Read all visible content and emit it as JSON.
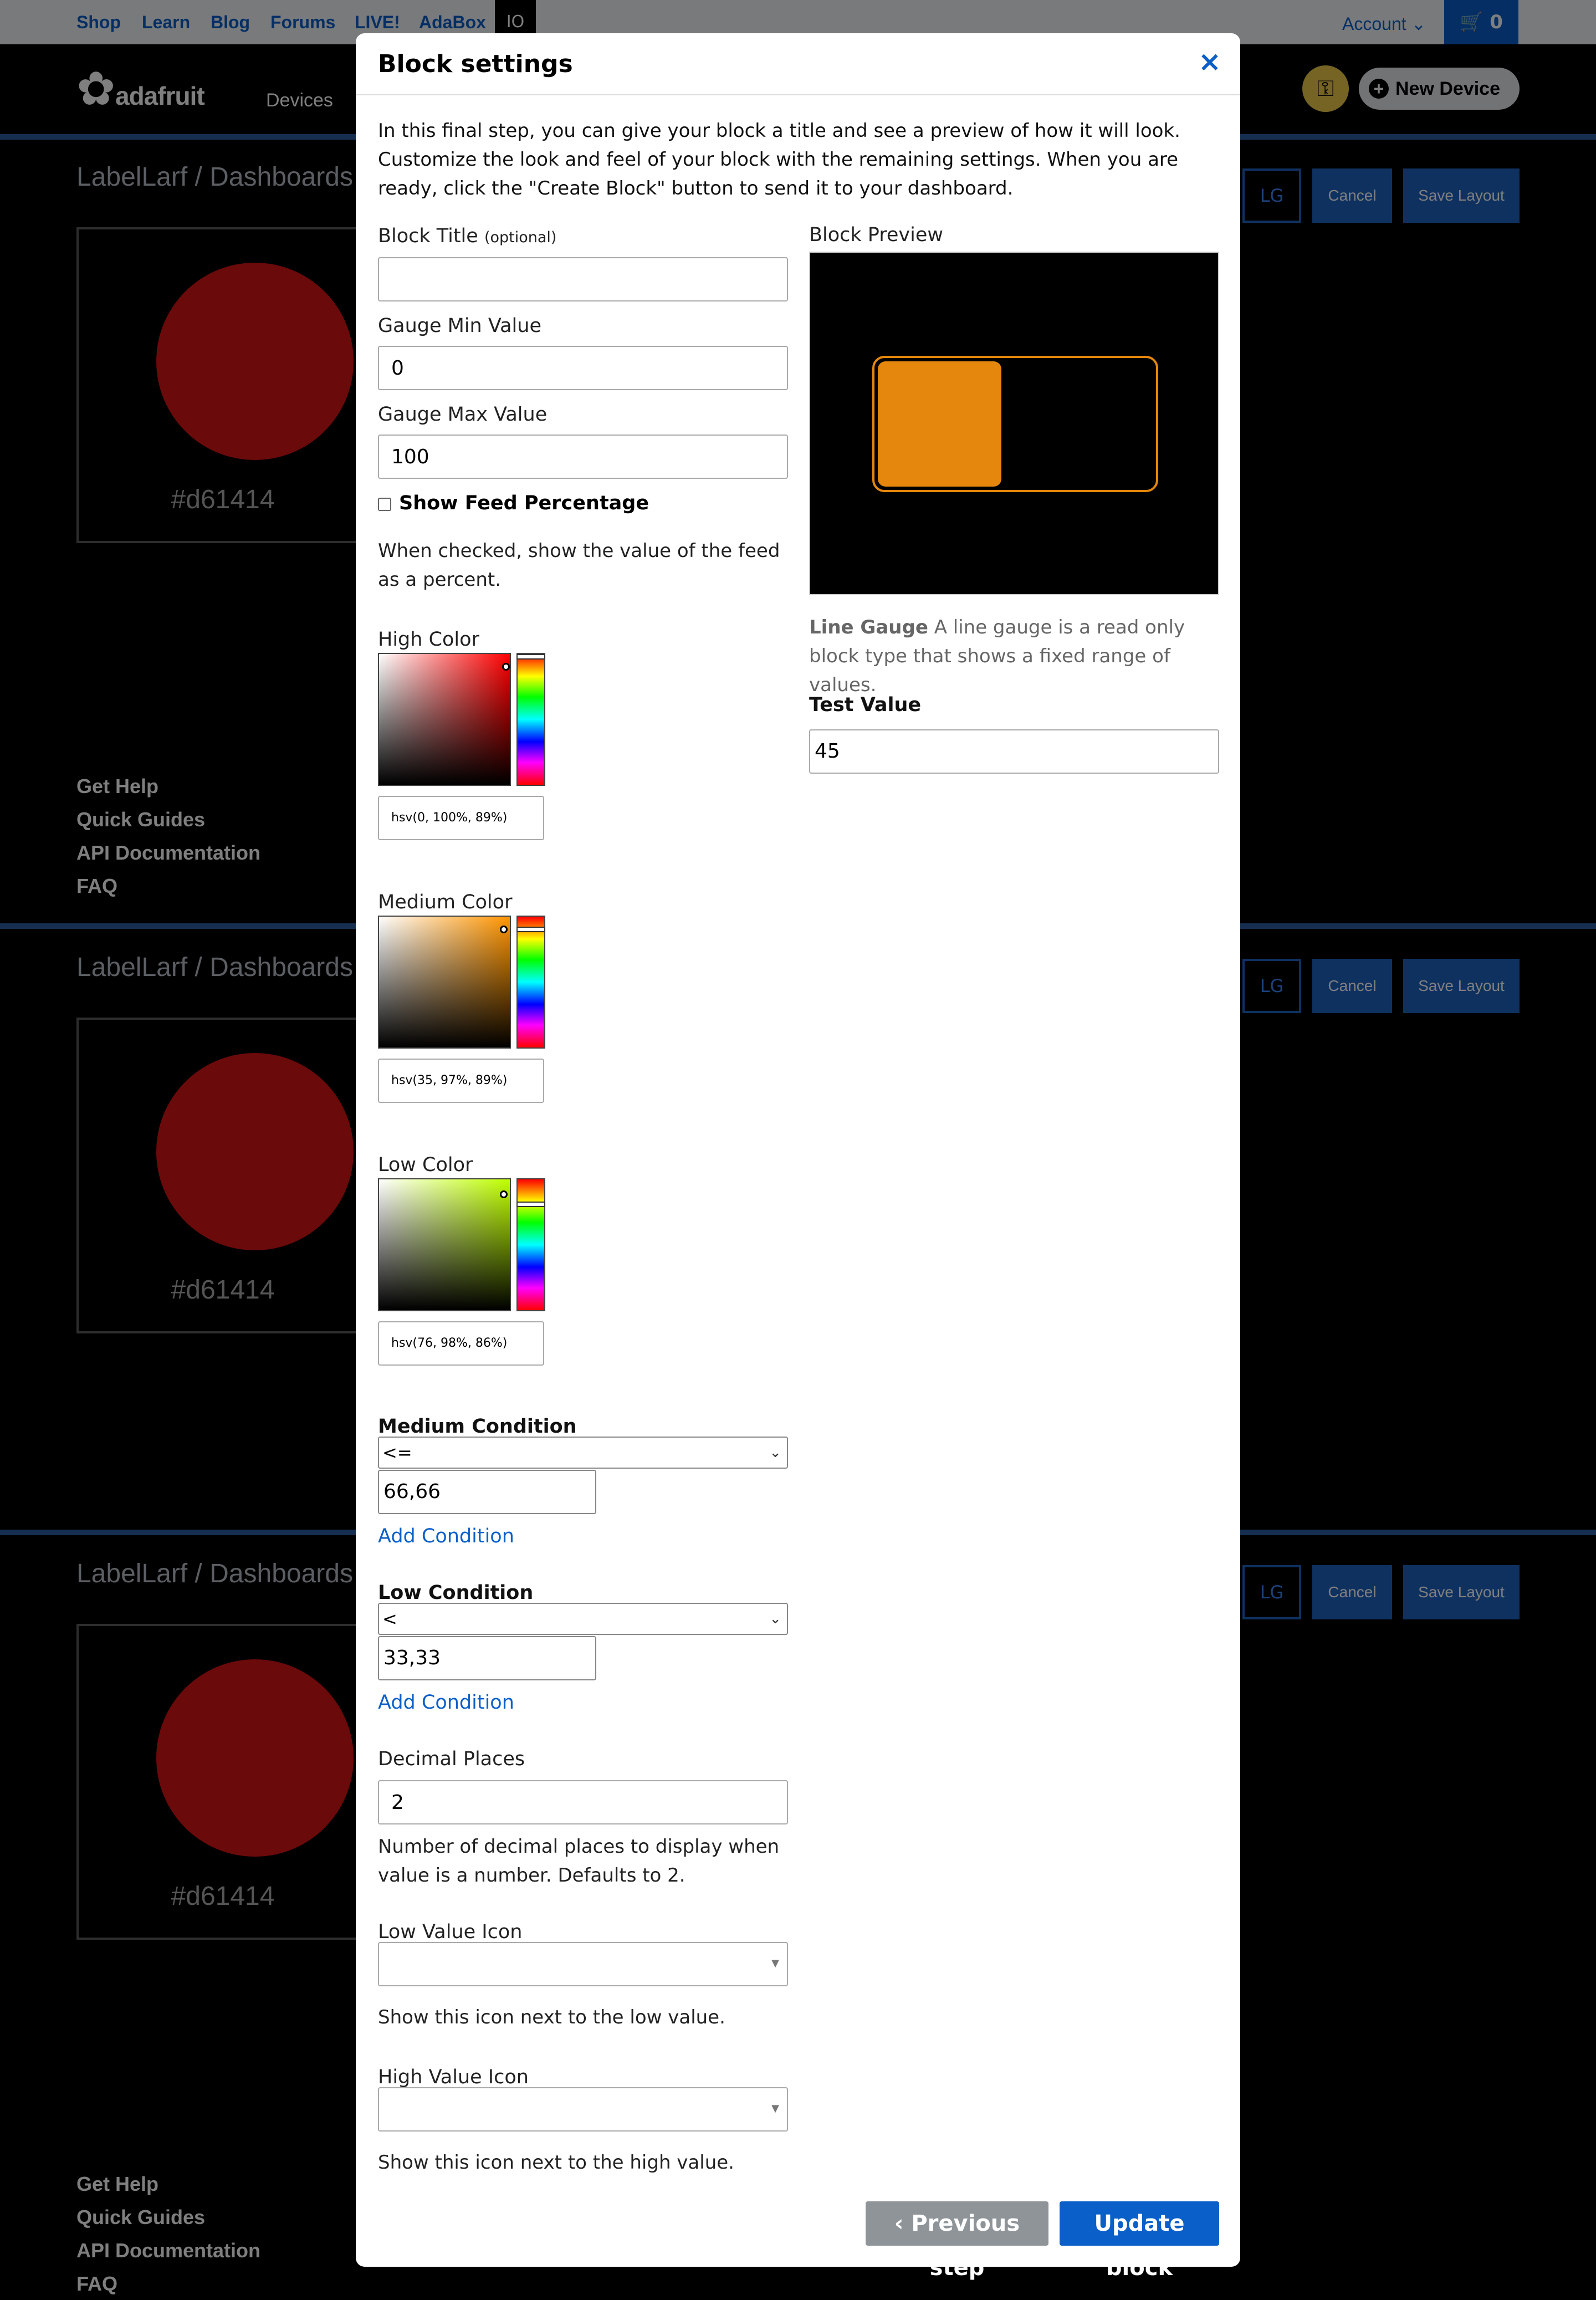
{
  "topbar": {
    "links": [
      "Shop",
      "Learn",
      "Blog",
      "Forums",
      "LIVE!",
      "AdaBox"
    ],
    "io_tab": "IO",
    "account": "Account",
    "cart_count": "0"
  },
  "nav": {
    "logo_text": "adafruit",
    "devices": "Devices",
    "new_device": "New Device"
  },
  "background": {
    "breadcrumb": "LabelLarf / Dashboards /",
    "block_color_label": "#d61414",
    "block_color": "#d61414",
    "lg_label": "LG",
    "cancel": "Cancel",
    "save_layout": "Save Layout",
    "footer_links": [
      "Get Help",
      "Quick Guides",
      "API Documentation",
      "FAQ"
    ]
  },
  "modal": {
    "title": "Block settings",
    "close": "×",
    "intro": "In this final step, you can give your block a title and see a preview of how it will look. Customize the look and feel of your block with the remaining settings. When you are ready, click the \"Create Block\" button to send it to your dashboard.",
    "block_title": {
      "label": "Block Title",
      "optional": "(optional)",
      "value": ""
    },
    "gauge_min": {
      "label": "Gauge Min Value",
      "value": "0"
    },
    "gauge_max": {
      "label": "Gauge Max Value",
      "value": "100"
    },
    "show_percentage": {
      "label": "Show Feed Percentage",
      "checked": false,
      "help": "When checked, show the value of the feed as a percent."
    },
    "high_color": {
      "label": "High Color",
      "value": "hsv(0, 100%, 89%)",
      "hue_color": "#ff0000"
    },
    "medium_color": {
      "label": "Medium Color",
      "value": "hsv(35, 97%, 89%)",
      "hue_color": "#ff9500"
    },
    "low_color": {
      "label": "Low Color",
      "value": "hsv(76, 98%, 86%)",
      "hue_color": "#bfff00"
    },
    "medium_condition": {
      "label": "Medium Condition",
      "operator": "<=",
      "value": "66,66",
      "add": "Add Condition"
    },
    "low_condition": {
      "label": "Low Condition",
      "operator": "<",
      "value": "33,33",
      "add": "Add Condition"
    },
    "decimal_places": {
      "label": "Decimal Places",
      "value": "2",
      "help": "Number of decimal places to display when value is a number. Defaults to 2."
    },
    "low_icon": {
      "label": "Low Value Icon",
      "value": "",
      "help": "Show this icon next to the low value."
    },
    "high_icon": {
      "label": "High Value Icon",
      "value": "",
      "help": "Show this icon next to the high value."
    },
    "preview": {
      "label": "Block Preview",
      "gauge_color": "#e5870c",
      "fill_fraction": 0.45,
      "type_name": "Line Gauge",
      "type_desc": "A line gauge is a read only block type that shows a fixed range of values."
    },
    "test_value": {
      "label": "Test Value",
      "value": "45"
    },
    "buttons": {
      "previous": "Previous step",
      "update": "Update block"
    }
  }
}
